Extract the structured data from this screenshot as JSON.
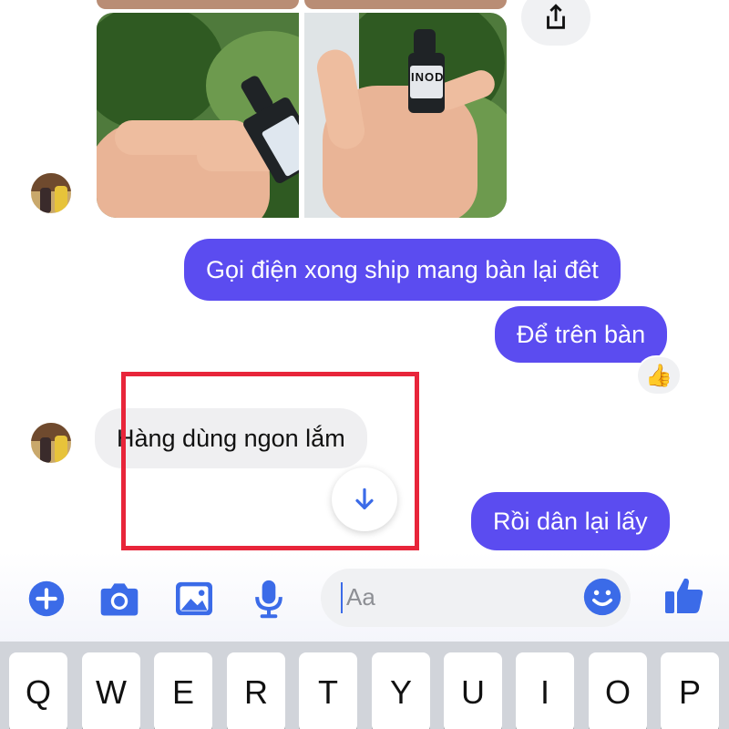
{
  "messages": {
    "out1": "Gọi điện xong ship mang bàn lại đêt",
    "out2": "Để trên bàn",
    "in1": "Hàng dùng ngon lắm",
    "out3": "Rồi dân lại lấy"
  },
  "photo_label_text": "INOD",
  "reaction_emoji": "👍",
  "composer": {
    "placeholder": "Aa",
    "icons": [
      "plus-icon",
      "camera-icon",
      "image-icon",
      "microphone-icon",
      "emoji-icon",
      "thumbs-up-icon"
    ]
  },
  "keyboard": {
    "row1": [
      "Q",
      "W",
      "E",
      "R",
      "T",
      "Y",
      "U",
      "I",
      "O",
      "P"
    ]
  },
  "colors": {
    "accent": "#5b4cf0",
    "icon_blue": "#3b6be8",
    "highlight_red": "#e8253a"
  }
}
